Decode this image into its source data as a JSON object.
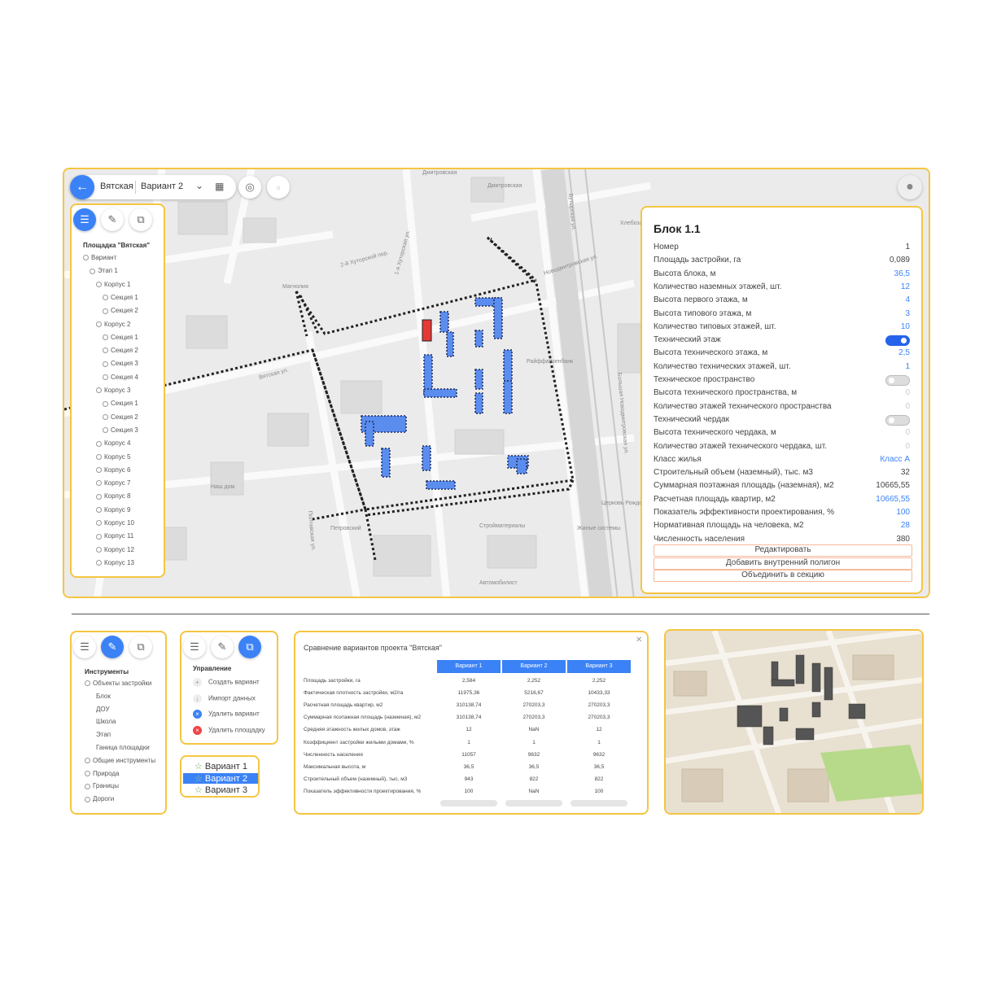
{
  "topbar": {
    "project_name": "Вятская",
    "variant_select": "Вариант 2"
  },
  "tree": {
    "title": "Площадка \"Вятская\"",
    "items": [
      {
        "label": "Вариант",
        "level": 0
      },
      {
        "label": "Этап 1",
        "level": 1
      },
      {
        "label": "Корпус 1",
        "level": 2
      },
      {
        "label": "Секция 1",
        "level": 3
      },
      {
        "label": "Секция 2",
        "level": 3
      },
      {
        "label": "Корпус 2",
        "level": 2
      },
      {
        "label": "Секция 1",
        "level": 3
      },
      {
        "label": "Секция 2",
        "level": 3
      },
      {
        "label": "Секция 3",
        "level": 3
      },
      {
        "label": "Секция 4",
        "level": 3
      },
      {
        "label": "Корпус 3",
        "level": 2
      },
      {
        "label": "Секция 1",
        "level": 3
      },
      {
        "label": "Секция 2",
        "level": 3
      },
      {
        "label": "Секция 3",
        "level": 3
      },
      {
        "label": "Корпус 4",
        "level": 2
      },
      {
        "label": "Корпус 5",
        "level": 2
      },
      {
        "label": "Корпус 6",
        "level": 2
      },
      {
        "label": "Корпус 7",
        "level": 2
      },
      {
        "label": "Корпус 8",
        "level": 2
      },
      {
        "label": "Корпус 9",
        "level": 2
      },
      {
        "label": "Корпус 10",
        "level": 2
      },
      {
        "label": "Корпус 11",
        "level": 2
      },
      {
        "label": "Корпус 12",
        "level": 2
      },
      {
        "label": "Корпус 13",
        "level": 2
      }
    ]
  },
  "map_labels": [
    "Дмитровская",
    "Дмитровская",
    "2-й Хуторской пер.",
    "1-я Хуторская ул.",
    "Бутырская ул.",
    "Новодмитровская ул.",
    "Хлебозавод №",
    "Магнолия",
    "Райффайзенбанк",
    "Наш дом",
    "Стройматериалы",
    "Петровский",
    "Автомобилист",
    "Церковь Рождества Богородицы",
    "Жилые системы",
    "Большая Новодмитровская ул.",
    "Вятская ул.",
    "Полтавская ул."
  ],
  "info": {
    "title": "Блок 1.1",
    "rows": [
      {
        "label": "Номер",
        "value": "1",
        "style": "normal"
      },
      {
        "label": "Площадь застройки, га",
        "value": "0,089",
        "style": "normal"
      },
      {
        "label": "Высота блока, м",
        "value": "36,5",
        "style": "blue"
      },
      {
        "label": "Количество наземных этажей, шт.",
        "value": "12",
        "style": "blue"
      },
      {
        "label": "Высота первого этажа, м",
        "value": "4",
        "style": "blue"
      },
      {
        "label": "Высота типового этажа, м",
        "value": "3",
        "style": "blue"
      },
      {
        "label": "Количество типовых этажей, шт.",
        "value": "10",
        "style": "blue"
      },
      {
        "label": "Технический этаж",
        "value": "",
        "style": "toggle-on"
      },
      {
        "label": "Высота технического этажа, м",
        "value": "2,5",
        "style": "blue"
      },
      {
        "label": "Количество технических этажей, шт.",
        "value": "1",
        "style": "blue"
      },
      {
        "label": "Техническое пространство",
        "value": "",
        "style": "toggle-off"
      },
      {
        "label": "Высота технического пространства, м",
        "value": "0",
        "style": "gray"
      },
      {
        "label": "Количество этажей технического пространства",
        "value": "0",
        "style": "gray"
      },
      {
        "label": "Технический чердак",
        "value": "",
        "style": "toggle-off"
      },
      {
        "label": "Высота технического чердака, м",
        "value": "0",
        "style": "gray"
      },
      {
        "label": "Количество этажей технического чердака, шт.",
        "value": "0",
        "style": "gray"
      },
      {
        "label": "Класс жилья",
        "value": "Класс А",
        "style": "blue"
      },
      {
        "label": "Строительный объем (наземный), тыс. м3",
        "value": "32",
        "style": "normal"
      },
      {
        "label": "Суммарная поэтажная площадь (наземная), м2",
        "value": "10665,55",
        "style": "normal"
      },
      {
        "label": "Расчетная площадь квартир, м2",
        "value": "10665,55",
        "style": "blue"
      },
      {
        "label": "Показатель эффективности проектирования, %",
        "value": "100",
        "style": "blue"
      },
      {
        "label": "Нормативная площадь на человека, м2",
        "value": "28",
        "style": "blue"
      },
      {
        "label": "Численность населения",
        "value": "380",
        "style": "normal"
      }
    ],
    "buttons": [
      "Редактировать",
      "Добавить внутренний полигон",
      "Объединить в секцию"
    ]
  },
  "tools": {
    "title": "Инструменты",
    "items": [
      {
        "label": "Объекты застройки",
        "level": 0
      },
      {
        "label": "Блок",
        "level": 1
      },
      {
        "label": "ДОУ",
        "level": 1
      },
      {
        "label": "Школа",
        "level": 1
      },
      {
        "label": "Этап",
        "level": 1
      },
      {
        "label": "Ганица площадки",
        "level": 1
      },
      {
        "label": "Общие инструменты",
        "level": 0
      },
      {
        "label": "Природа",
        "level": 0
      },
      {
        "label": "Границы",
        "level": 0
      },
      {
        "label": "Дороги",
        "level": 0
      }
    ]
  },
  "management": {
    "title": "Управление",
    "items": [
      {
        "label": "Создать вариант",
        "icon": "plus"
      },
      {
        "label": "Импорт данных",
        "icon": "import"
      },
      {
        "label": "Удалить вариант",
        "icon": "remove-blue"
      },
      {
        "label": "Удалить площадку",
        "icon": "remove-red"
      }
    ]
  },
  "variants": {
    "items": [
      "Вариант 1",
      "Вариант 2",
      "Вариант 3"
    ],
    "selected": 1
  },
  "compare": {
    "title": "Сравнение вариантов проекта \"Вятская\"",
    "columns": [
      "Вариант 1",
      "Вариант 2",
      "Вариант 3"
    ],
    "rows": [
      {
        "label": "Площадь застройки, га",
        "values": [
          "2,584",
          "2,252",
          "2,252"
        ]
      },
      {
        "label": "Фактическая плотность застройки, м2/га",
        "values": [
          "11975,36",
          "5216,67",
          "10433,33"
        ]
      },
      {
        "label": "Расчетная площадь квартир, м2",
        "values": [
          "310138,74",
          "270203,3",
          "270203,3"
        ]
      },
      {
        "label": "Суммарная поэтажная площадь (наземная), м2",
        "values": [
          "310138,74",
          "270203,3",
          "270203,3"
        ]
      },
      {
        "label": "Средняя этажность жилых домов, этаж",
        "values": [
          "12",
          "NaN",
          "12"
        ]
      },
      {
        "label": "Коэффициент застройки жилыми домами, %",
        "values": [
          "1",
          "1",
          "1"
        ]
      },
      {
        "label": "Численность населения",
        "values": [
          "11057",
          "9632",
          "9632"
        ]
      },
      {
        "label": "Максимальная высота, м",
        "values": [
          "36,5",
          "36,5",
          "36,5"
        ]
      },
      {
        "label": "Строительный объем (наземный), тыс. м3",
        "values": [
          "943",
          "822",
          "822"
        ]
      },
      {
        "label": "Показатель эффективности проектирования, %",
        "values": [
          "100",
          "NaN",
          "100"
        ]
      }
    ]
  },
  "colors": {
    "accent": "#3b82f6",
    "frame": "#f5c542",
    "selected_block": "#e53935",
    "block": "#5b8def"
  }
}
